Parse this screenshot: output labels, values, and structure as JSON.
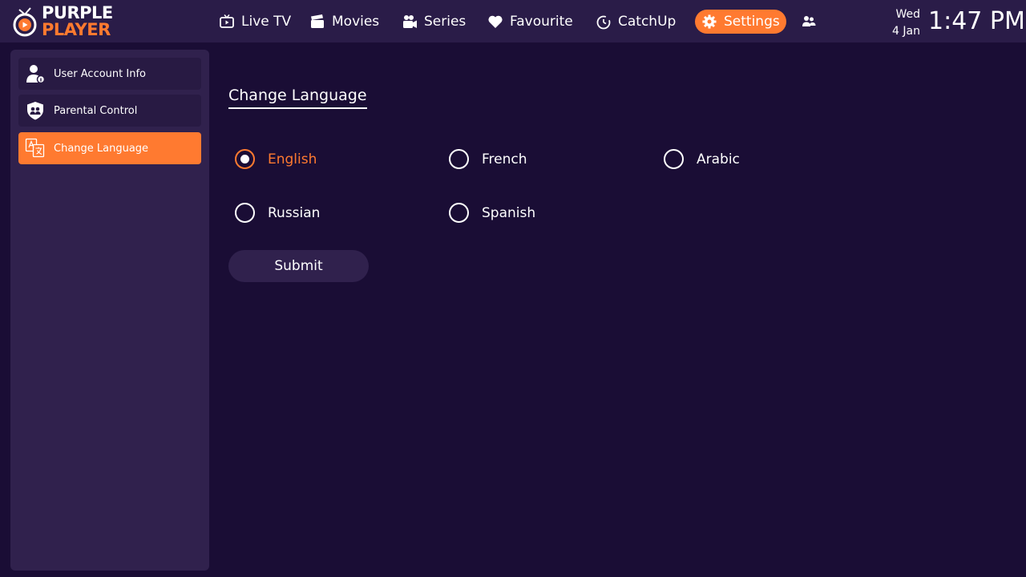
{
  "app": {
    "logo_word1": "PURPLE",
    "logo_word2": "PLAYER",
    "accent_color": "#ff7a30"
  },
  "nav": {
    "items": [
      {
        "label": "Live TV",
        "icon": "tv-icon"
      },
      {
        "label": "Movies",
        "icon": "clapperboard-icon"
      },
      {
        "label": "Series",
        "icon": "camera-icon"
      },
      {
        "label": "Favourite",
        "icon": "heart-icon"
      },
      {
        "label": "CatchUp",
        "icon": "timer-icon"
      },
      {
        "label": "Settings",
        "icon": "gear-icon",
        "active": true
      }
    ],
    "profile_icon": "users-switch-icon"
  },
  "datetime": {
    "day": "Wed",
    "date": "4 Jan",
    "time": "1:47 PM"
  },
  "sidebar": {
    "items": [
      {
        "label": "User Account Info",
        "icon": "user-info-icon"
      },
      {
        "label": "Parental Control",
        "icon": "shield-users-icon"
      },
      {
        "label": "Change Language",
        "icon": "translate-icon",
        "active": true
      }
    ]
  },
  "main": {
    "title": "Change Language",
    "languages": [
      {
        "label": "English",
        "selected": true
      },
      {
        "label": "French",
        "selected": false
      },
      {
        "label": "Arabic",
        "selected": false
      },
      {
        "label": "Russian",
        "selected": false
      },
      {
        "label": "Spanish",
        "selected": false
      }
    ],
    "submit_label": "Submit"
  }
}
